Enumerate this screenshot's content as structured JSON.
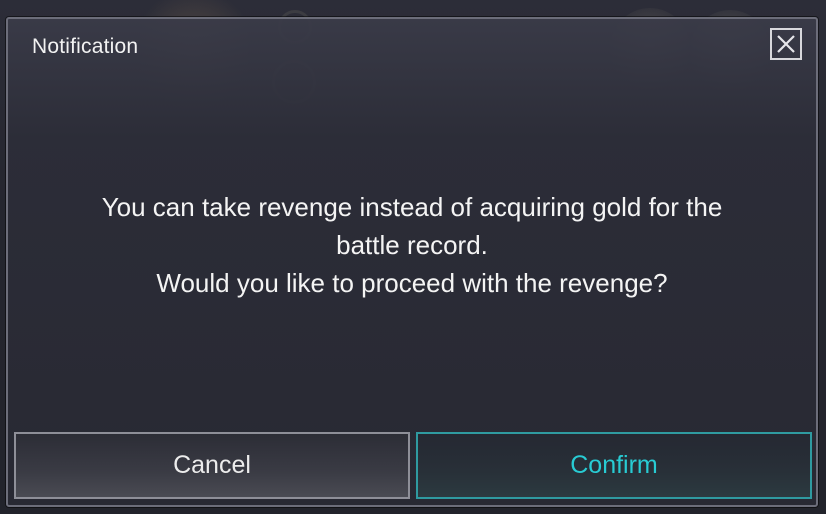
{
  "dialog": {
    "title": "Notification",
    "close_icon": "close-icon",
    "message_lines": [
      "You can take revenge instead of acquiring gold for the",
      "battle record.",
      "Would you like to proceed with the revenge?"
    ],
    "cancel_label": "Cancel",
    "confirm_label": "Confirm"
  },
  "colors": {
    "dialog_bg": "#2c2d38",
    "dialog_border": "#6c6d7a",
    "text": "#f4f4f4",
    "confirm_accent": "#28cbd3",
    "confirm_border": "#2f9aa0",
    "cancel_border": "#8e8f98"
  }
}
